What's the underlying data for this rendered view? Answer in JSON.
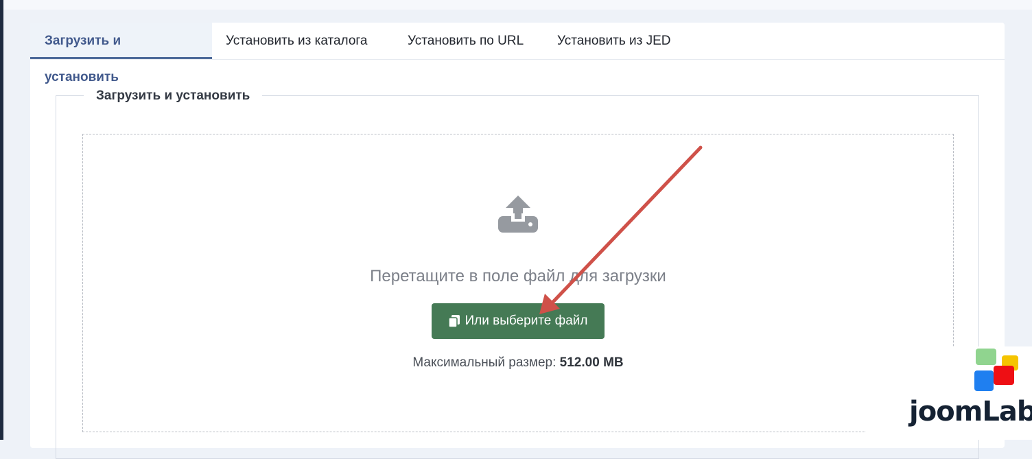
{
  "tabs": [
    {
      "label": "Загрузить и установить",
      "active": true
    },
    {
      "label": "Установить из каталога",
      "active": false
    },
    {
      "label": "Установить по URL",
      "active": false
    },
    {
      "label": "Установить из JED",
      "active": false
    }
  ],
  "panel": {
    "legend": "Загрузить и установить",
    "drop_text": "Перетащите в поле файл для загрузки",
    "choose_button_label": "Или выберите файл",
    "max_size_label": "Максимальный размер:",
    "max_size_value": "512.00 MB"
  },
  "icons": {
    "upload": "upload-icon",
    "copy": "copy-icon"
  },
  "colors": {
    "accent": "#457a55",
    "tab_active": "#41598c",
    "annotation_arrow": "#cf5149"
  },
  "watermark": {
    "logo_text": "joomLab"
  }
}
